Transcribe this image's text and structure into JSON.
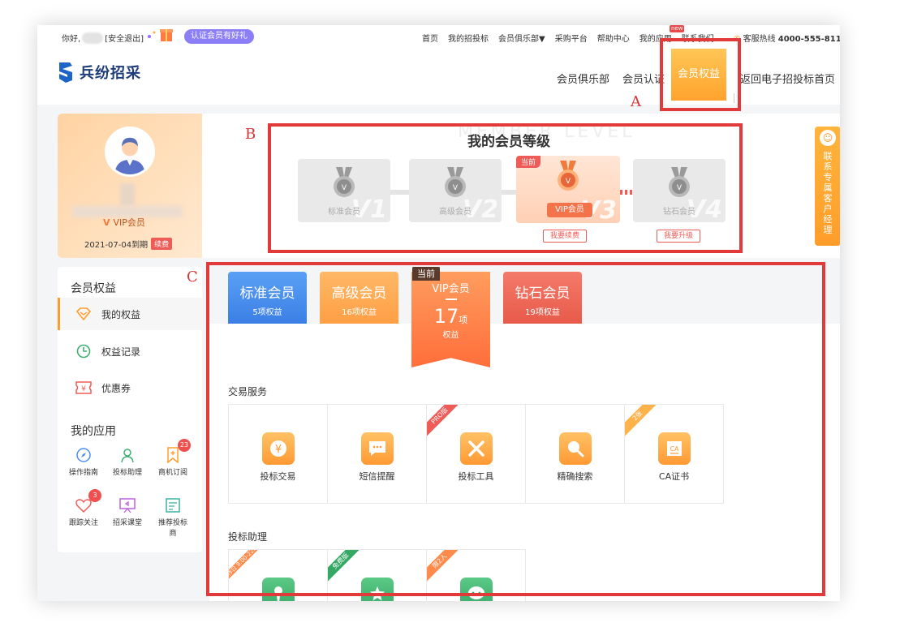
{
  "topbar": {
    "greeting": "你好,",
    "logout": "[安全退出]",
    "cert_promo": "认证会员有好礼",
    "nav": [
      "首页",
      "我的招投标",
      "会员俱乐部▼",
      "采购平台",
      "帮助中心",
      "我的应用",
      "联系我们"
    ],
    "new_badge": "new",
    "hotline_label": "客服热线",
    "hotline_number": "4000-555-811"
  },
  "header": {
    "logo_text": "兵纷招采",
    "nav": [
      "会员俱乐部",
      "会员认证",
      "会员权益",
      "返回电子招投标首页"
    ],
    "active_nav": "会员权益"
  },
  "annotations": {
    "a": "A",
    "b": "B",
    "c": "C"
  },
  "profile": {
    "level": "VIP会员",
    "expire": "2021-07-04到期",
    "renew": "续费"
  },
  "levels": {
    "title": "我的会员等级",
    "watermark": "MEMBER LEVEL",
    "cards": [
      {
        "label": "标准会员",
        "mark": "V1",
        "current": false
      },
      {
        "label": "高级会员",
        "mark": "V2",
        "current": false
      },
      {
        "label": "VIP会员",
        "mark": "V3",
        "current": true
      },
      {
        "label": "钻石会员",
        "mark": "V4",
        "current": false
      }
    ],
    "current_tag": "当前",
    "renew_button": "我要续费",
    "upgrade_button": "我要升级"
  },
  "contact_manager": "联系专属客户经理",
  "sidebar": {
    "benefits_heading": "会员权益",
    "items": [
      {
        "label": "我的权益",
        "icon": "diamond-icon",
        "active": true
      },
      {
        "label": "权益记录",
        "icon": "clock-icon",
        "active": false
      },
      {
        "label": "优惠券",
        "icon": "coupon-icon",
        "active": false
      }
    ],
    "apps_heading": "我的应用",
    "apps": [
      {
        "label": "操作指南",
        "icon": "compass-icon",
        "badge": ""
      },
      {
        "label": "投标助理",
        "icon": "assistant-icon",
        "badge": ""
      },
      {
        "label": "商机订阅",
        "icon": "bookmark-icon",
        "badge": "23"
      },
      {
        "label": "跟踪关注",
        "icon": "heart-icon",
        "badge": "3"
      },
      {
        "label": "招采课堂",
        "icon": "classroom-icon",
        "badge": ""
      },
      {
        "label": "推荐投标商",
        "icon": "recommend-icon",
        "badge": ""
      }
    ]
  },
  "tabs": [
    {
      "name": "标准会员",
      "count": "5项权益",
      "color": "#4a8ef0"
    },
    {
      "name": "高级会员",
      "count": "16项权益",
      "color": "#ffaa55"
    },
    {
      "name": "VIP会员",
      "count_num": "17",
      "count_unit": "项",
      "count_label": "权益",
      "current_tag": "当前"
    },
    {
      "name": "钻石会员",
      "count": "19项权益",
      "color": "#f36f5f"
    }
  ],
  "sections": [
    {
      "title": "交易服务",
      "items": [
        {
          "label": "投标交易",
          "icon": "yen-icon",
          "ribbon": ""
        },
        {
          "label": "短信提醒",
          "icon": "message-icon",
          "ribbon": ""
        },
        {
          "label": "投标工具",
          "icon": "tools-icon",
          "ribbon": "PRO版"
        },
        {
          "label": "精确搜索",
          "icon": "search-icon",
          "ribbon": ""
        },
        {
          "label": "CA证书",
          "icon": "ca-icon",
          "ribbon": "2张"
        }
      ]
    },
    {
      "title": "投标助理",
      "items": [
        {
          "label": "",
          "icon": "person-icon",
          "ribbon": "工作日 8:00-22:00"
        },
        {
          "label": "",
          "icon": "star-icon",
          "ribbon": "免费版"
        },
        {
          "label": "",
          "icon": "chat-icon",
          "ribbon": "限2人"
        }
      ]
    }
  ]
}
